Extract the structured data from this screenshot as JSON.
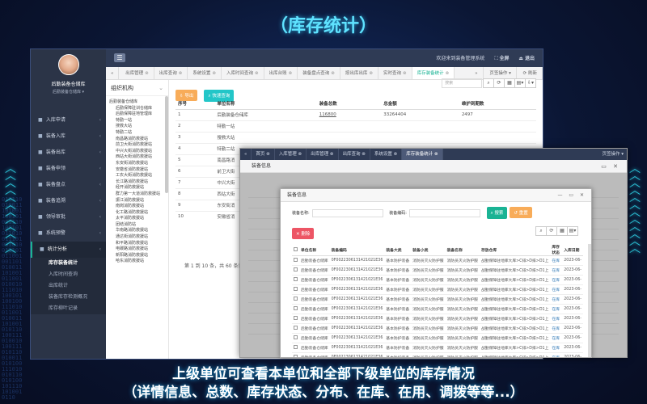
{
  "title": "（库存统计）",
  "caption": {
    "line1": "上级单位可查看本单位和全部下级单位的库存情况",
    "line2": "（详情信息、总数、库存状态、分布、在库、在用、调拨等等...）"
  },
  "colors": {
    "accent": "#1ab394",
    "title": "#5fe3ff",
    "sidebar": "#2b3447",
    "topbar": "#2f3b55"
  },
  "profile": {
    "name": "后勤装备仓储库",
    "role": "后勤装备仓储库"
  },
  "sidebar": {
    "items": [
      {
        "label": "入库申请",
        "icon": "inbox-icon"
      },
      {
        "label": "装备入库",
        "icon": "box-icon"
      },
      {
        "label": "装备出库",
        "icon": "share-icon"
      },
      {
        "label": "装备申领",
        "icon": "hand-icon"
      },
      {
        "label": "装备盘点",
        "icon": "check-icon"
      },
      {
        "label": "装备追溯",
        "icon": "trace-icon"
      },
      {
        "label": "领导审批",
        "icon": "stamp-icon"
      },
      {
        "label": "系统预警",
        "icon": "bell-icon"
      },
      {
        "label": "统计分析",
        "icon": "chart-icon"
      }
    ],
    "submenu": [
      "库存装备统计",
      "入库时间查询",
      "出库统计",
      "装备库存检测概况",
      "库存柳叶记录"
    ]
  },
  "topbar": {
    "welcome": "欢迎来到装备管理系统",
    "fullscreen": "全屏",
    "logout": "退出"
  },
  "tabs": [
    "出库管理",
    "出库查询",
    "系统设置",
    "入库时间查询",
    "出库台账",
    "装备盘点查询",
    "按出库出库",
    "实时查询",
    "库存装备统计"
  ],
  "tab_ops": "页签操作",
  "refresh": "刷新",
  "org": {
    "title": "组织机构",
    "tree": [
      {
        "label": "后勤装备仓储库",
        "level": 0
      },
      {
        "label": "后勤保障驻训仓储库",
        "level": 1
      },
      {
        "label": "后勤保障驻地管理库",
        "level": 1
      },
      {
        "label": "特勤一站",
        "level": 1
      },
      {
        "label": "搜救大站",
        "level": 1
      },
      {
        "label": "特勤二站",
        "level": 1
      },
      {
        "label": "南昌路消防救援站",
        "level": 1
      },
      {
        "label": "前卫大街消防救援站",
        "level": 1
      },
      {
        "label": "中兴大街消防救援站",
        "level": 1
      },
      {
        "label": "西站大街消防救援站",
        "level": 1
      },
      {
        "label": "东安街消防救援站",
        "level": 1
      },
      {
        "label": "安徽省消防救援站",
        "level": 1
      },
      {
        "label": "工农大街消防救援站",
        "level": 1
      },
      {
        "label": "长江路消防救援站",
        "level": 1
      },
      {
        "label": "经开消防救援站",
        "level": 1
      },
      {
        "label": "群力第一大道消防救援站",
        "level": 1
      },
      {
        "label": "振江消防救援站",
        "level": 1
      },
      {
        "label": "南岗消防救援站",
        "level": 1
      },
      {
        "label": "化工路消防救援站",
        "level": 1
      },
      {
        "label": "太平消防救援站",
        "level": 1
      },
      {
        "label": "团结消防站",
        "level": 1
      },
      {
        "label": "华南路消防救援站",
        "level": 1
      },
      {
        "label": "通达街消防救援站",
        "level": 1
      },
      {
        "label": "和平路消防救援站",
        "level": 1
      },
      {
        "label": "电碳路消防救援站",
        "level": 1
      },
      {
        "label": "新阳路消防救援站",
        "level": 1
      },
      {
        "label": "哈东消防救援站",
        "level": 1
      }
    ]
  },
  "toolbar": {
    "export": "导出",
    "quick_query": "快速查询"
  },
  "search": {
    "placeholder": "搜索"
  },
  "main_table": {
    "columns": [
      "序号",
      "单位名称",
      "装备总数",
      "总金额",
      "维护到期数"
    ],
    "rows": [
      [
        "1",
        "后勤装备仓储库",
        "116800",
        "33264404",
        "2497"
      ],
      [
        "2",
        "特勤一站",
        "",
        "",
        ""
      ],
      [
        "3",
        "搜救大站",
        "",
        "",
        ""
      ],
      [
        "4",
        "特勤二站",
        "",
        "",
        ""
      ],
      [
        "5",
        "南昌路消",
        "",
        "",
        ""
      ],
      [
        "6",
        "前卫大街",
        "",
        "",
        ""
      ],
      [
        "7",
        "中兴大街",
        "",
        "",
        ""
      ],
      [
        "8",
        "西站大街",
        "",
        "",
        ""
      ],
      [
        "9",
        "东安街消",
        "",
        "",
        ""
      ],
      [
        "10",
        "安徽省消",
        "",
        "",
        ""
      ]
    ],
    "pager": "第 1 到 10 条，共 60 条记录。"
  },
  "dialog1": {
    "tabs": [
      "首页",
      "入库管理",
      "出库管理",
      "出库查询",
      "系统设置",
      "库存装备统计"
    ],
    "tab_ops": "页签操作",
    "title": "装备信息"
  },
  "dialog2": {
    "title": "装备信息",
    "filter_name_label": "装备名称:",
    "filter_code_label": "装备编码:",
    "search_btn": "搜索",
    "reset_btn": "重置",
    "delete_btn": "删除",
    "columns": [
      "单位名称",
      "装备编码",
      "装备大类",
      "装备小类",
      "装备名称",
      "存放仓库",
      "库存状态",
      "入库日期"
    ],
    "rows": [
      [
        "后勤装备仓储库",
        "0F0022306131421021E36",
        "基本防护装备",
        "消防员灭火防护服",
        "消防员灭火防护服",
        "战勤保障驻地库大库>C排>D排>D1上",
        "在库",
        "2023-06-"
      ],
      [
        "后勤装备仓储库",
        "0F0022306131421021E36",
        "基本防护装备",
        "消防员灭火防护服",
        "消防员灭火防护服",
        "战勤保障驻地库大库>C排>D排>D1上",
        "在库",
        "2023-06-"
      ],
      [
        "后勤装备仓储库",
        "0F0022306131421021E36",
        "基本防护装备",
        "消防员灭火防护服",
        "消防员灭火防护服",
        "战勤保障驻地库大库>C排>D排>D1上",
        "在库",
        "2023-06-"
      ],
      [
        "后勤装备仓储库",
        "0F0022306131421021E36",
        "基本防护装备",
        "消防员灭火防护服",
        "消防员灭火防护服",
        "战勤保障驻地库大库>C排>D排>D1上",
        "在库",
        "2023-06-"
      ],
      [
        "后勤装备仓储库",
        "0F0022306131421021E36",
        "基本防护装备",
        "消防员灭火防护服",
        "消防员灭火防护服",
        "战勤保障驻地库大库>C排>D排>D1上",
        "在库",
        "2023-06-"
      ],
      [
        "后勤装备仓储库",
        "0F0022306131421021E36",
        "基本防护装备",
        "消防员灭火防护服",
        "消防员灭火防护服",
        "战勤保障驻地库大库>C排>D排>D1上",
        "在库",
        "2023-06-"
      ],
      [
        "后勤装备仓储库",
        "0F0022306131421021E36",
        "基本防护装备",
        "消防员灭火防护服",
        "消防员灭火防护服",
        "战勤保障驻地库大库>C排>D排>D1上",
        "在库",
        "2023-06-"
      ],
      [
        "后勤装备仓储库",
        "0F0022306131421021E36",
        "基本防护装备",
        "消防员灭火防护服",
        "消防员灭火防护服",
        "战勤保障驻地库大库>C排>D排>D1上",
        "在库",
        "2023-06-"
      ],
      [
        "后勤装备仓储库",
        "0F0022306131421021E36",
        "基本防护装备",
        "消防员灭火防护服",
        "消防员灭火防护服",
        "战勤保障驻地库大库>C排>D排>D1上",
        "在库",
        "2023-06-"
      ],
      [
        "后勤装备仓储库",
        "0F0022306131421021E36",
        "基本防护装备",
        "消防员灭火防护服",
        "消防员灭火防护服",
        "战勤保障驻地库大库>C排>D排>D1上",
        "在库",
        "2023-06-"
      ],
      [
        "后勤装备仓储库",
        "0F0022306131421021E36",
        "基本防护装备",
        "消防员灭火防护服",
        "消防员灭火防护服",
        "战勤保障驻地库大库>C排>D排>D1上",
        "在库",
        "2023-06-"
      ]
    ]
  }
}
